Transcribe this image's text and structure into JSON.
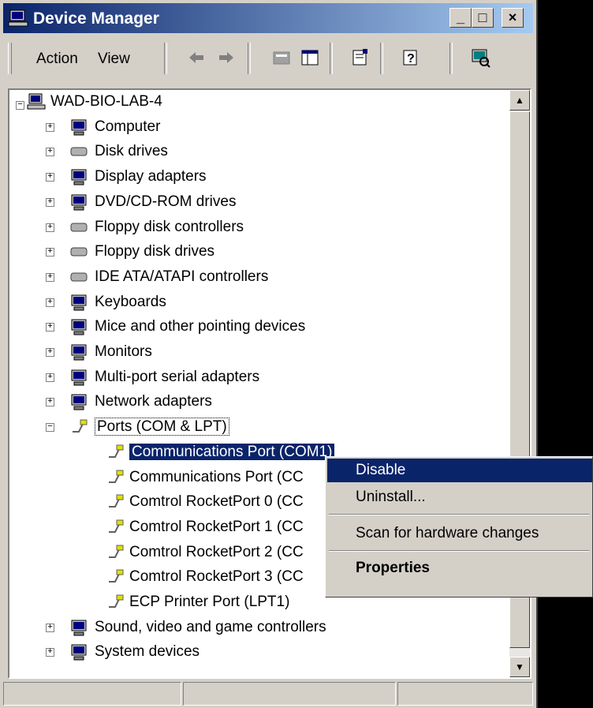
{
  "window": {
    "title": "Device Manager"
  },
  "menu": {
    "action": "Action",
    "view": "View"
  },
  "toolbar_icons": [
    "back-icon",
    "forward-icon",
    "up-folder-icon",
    "show-hide-tree-icon",
    "properties-icon",
    "help-icon",
    "scan-hardware-icon"
  ],
  "tree": {
    "root": "WAD-BIO-LAB-4",
    "categories": [
      "Computer",
      "Disk drives",
      "Display adapters",
      "DVD/CD-ROM drives",
      "Floppy disk controllers",
      "Floppy disk drives",
      "IDE ATA/ATAPI controllers",
      "Keyboards",
      "Mice and other pointing devices",
      "Monitors",
      "Multi-port serial adapters",
      "Network adapters",
      "Ports (COM & LPT)"
    ],
    "ports": [
      "Communications Port (COM1)",
      "Communications Port (CC",
      "Comtrol RocketPort 0 (CC",
      "Comtrol RocketPort 1 (CC",
      "Comtrol RocketPort 2 (CC",
      "Comtrol RocketPort 3 (CC",
      "ECP Printer Port (LPT1)"
    ],
    "after": [
      "Sound, video and game controllers",
      "System devices"
    ]
  },
  "context_menu": {
    "disable": "Disable",
    "uninstall": "Uninstall...",
    "scan": "Scan for hardware changes",
    "properties": "Properties"
  },
  "colors": {
    "selection": "#0a246a",
    "face": "#d4d0c8"
  }
}
